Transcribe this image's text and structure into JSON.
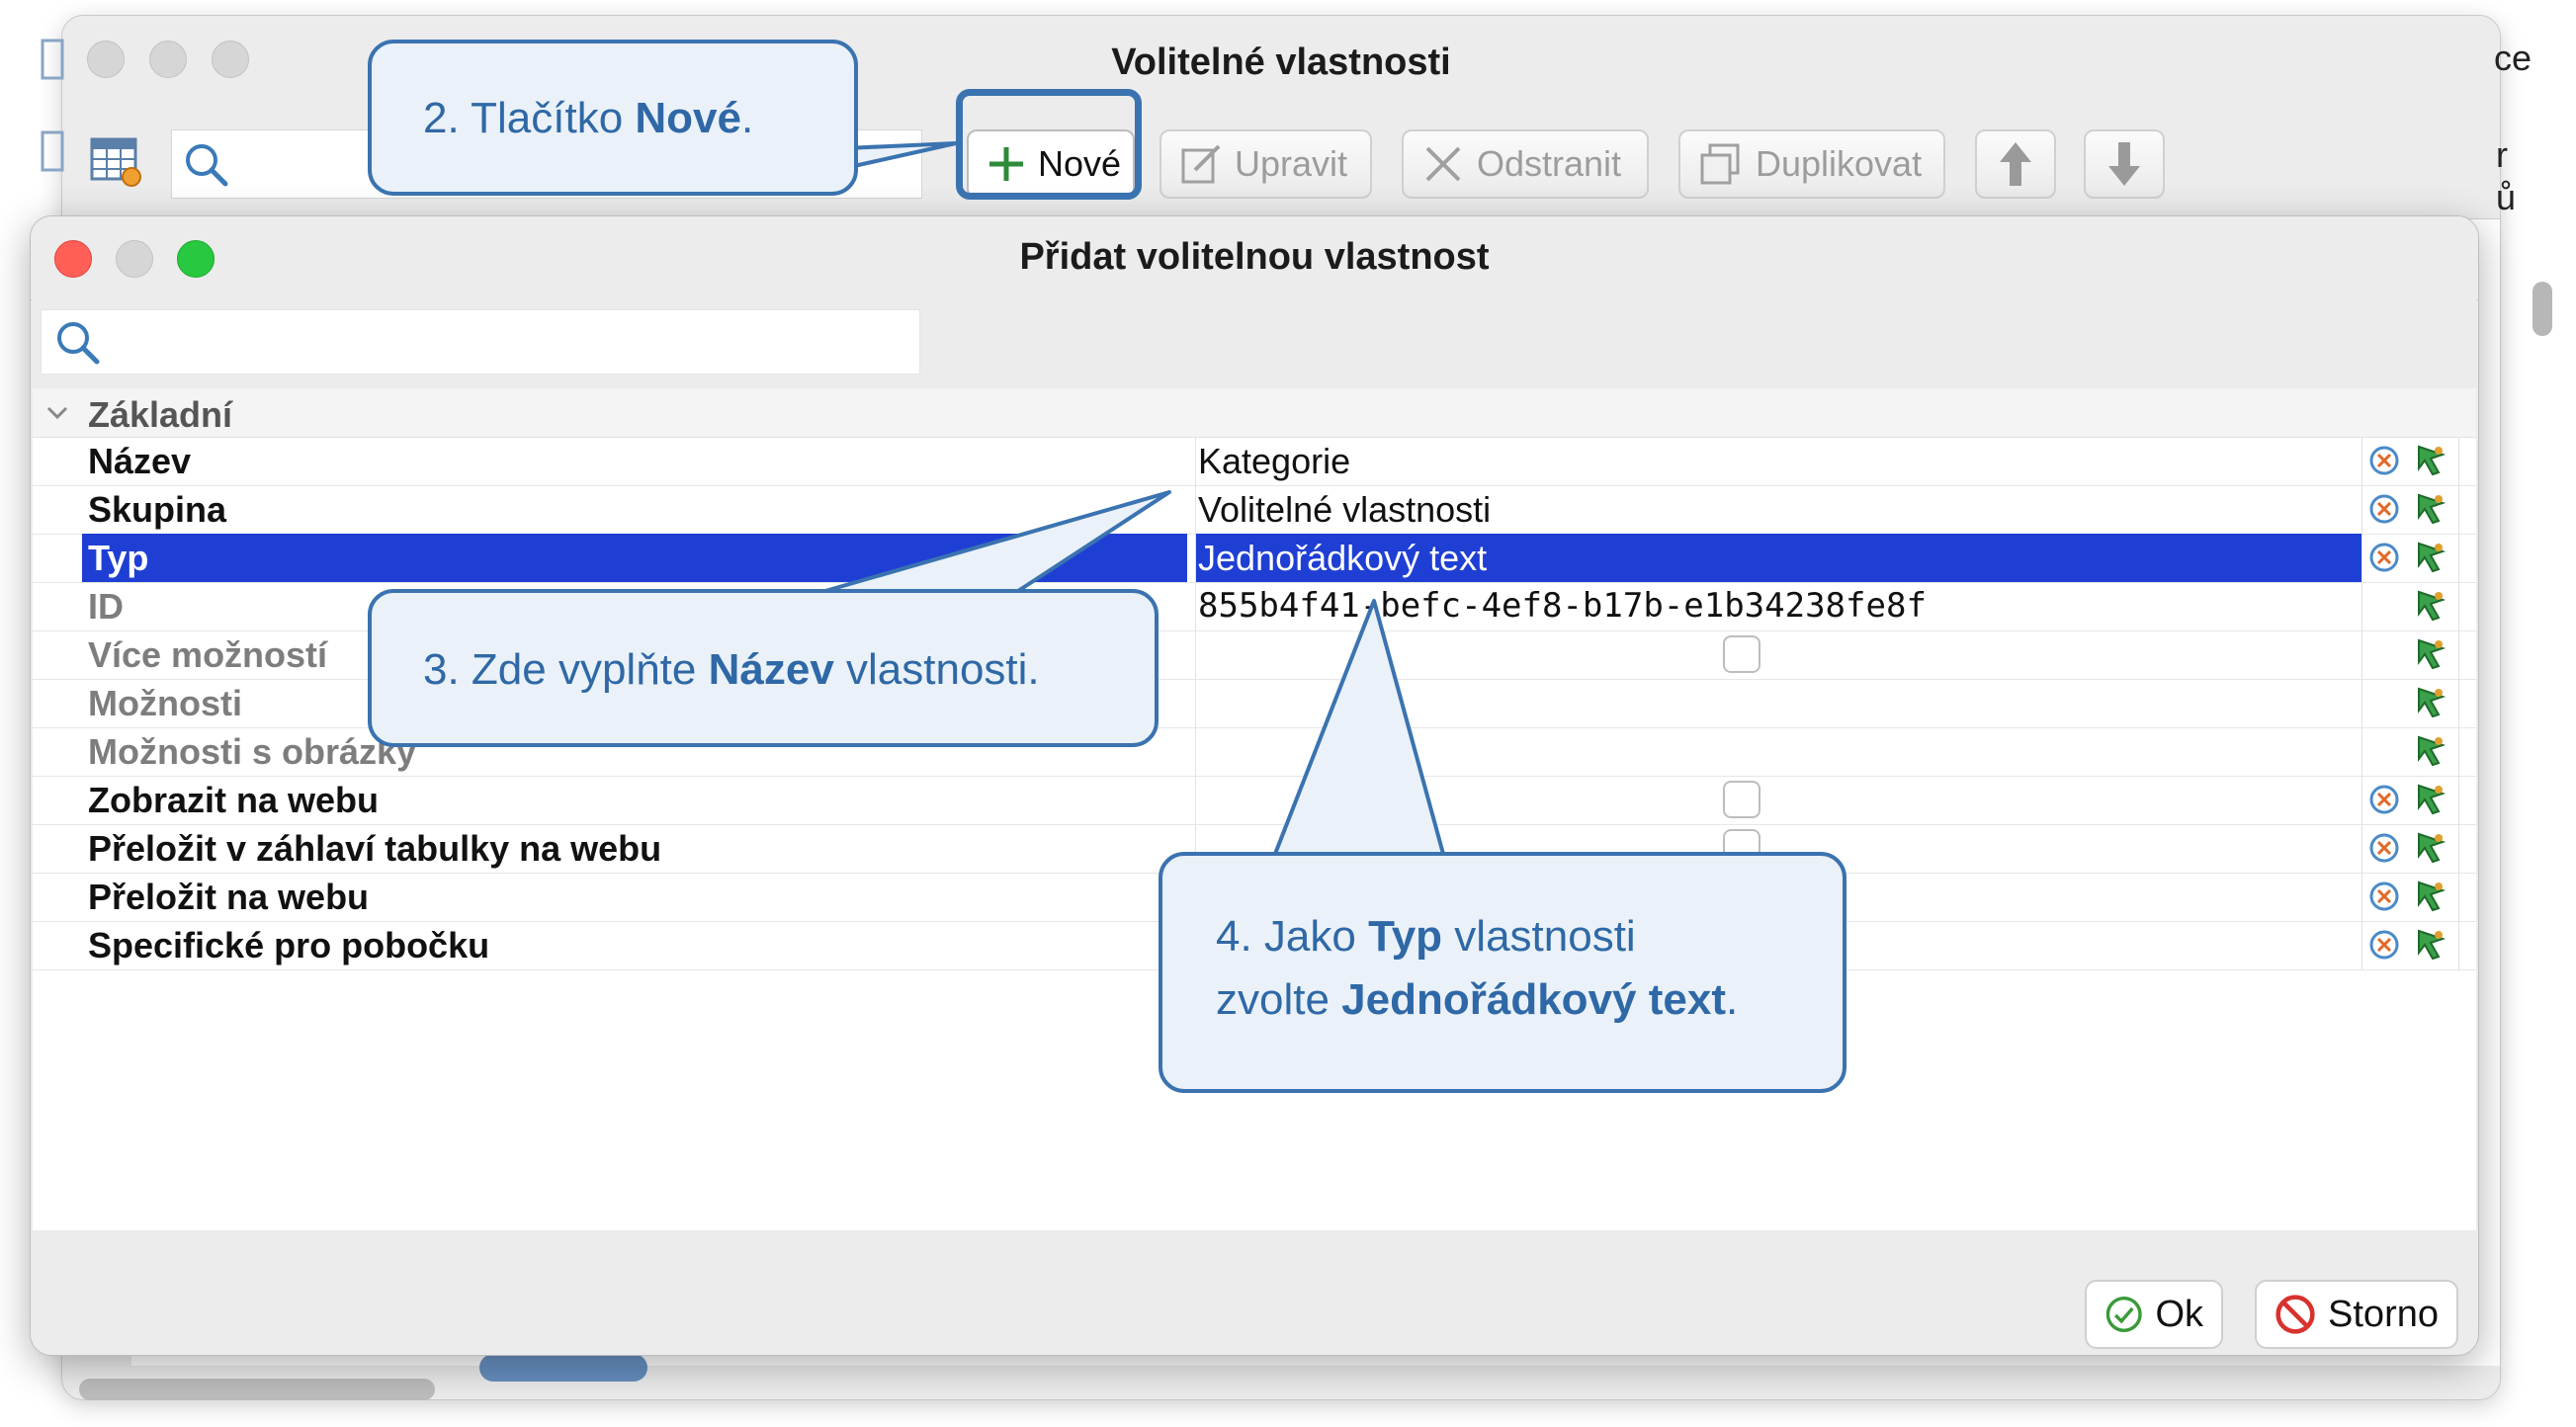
{
  "back_window": {
    "title": "Volitelné vlastnosti",
    "right_fragment_top": "ce",
    "right_fragment_mid1": "r",
    "right_fragment_mid2": "ů",
    "toolbar": {
      "new_label": "Nové",
      "edit_label": "Upravit",
      "delete_label": "Odstranit",
      "duplicate_label": "Duplikovat"
    }
  },
  "dialog": {
    "title": "Přidat volitelnou vlastnost",
    "group_label": "Základní",
    "rows": [
      {
        "name": "Název",
        "value": "Kategorie"
      },
      {
        "name": "Skupina",
        "value": "Volitelné vlastnosti"
      },
      {
        "name": "Typ",
        "value": "Jednořádkový text"
      },
      {
        "name": "ID",
        "value": "855b4f41-befc-4ef8-b17b-e1b34238fe8f"
      },
      {
        "name": "Více možností",
        "value": ""
      },
      {
        "name": "Možnosti",
        "value": ""
      },
      {
        "name": "Možnosti s obrázky",
        "value": ""
      },
      {
        "name": "Zobrazit na webu",
        "value": ""
      },
      {
        "name": "Přeložit v záhlaví tabulky na webu",
        "value": ""
      },
      {
        "name": "Přeložit na webu",
        "value": ""
      },
      {
        "name": "Specifické pro pobočku",
        "value": ""
      }
    ],
    "ok_label": "Ok",
    "cancel_label": "Storno"
  },
  "callouts": {
    "c2": {
      "prefix": "2. Tlačítko ",
      "bold": "Nové",
      "suffix": "."
    },
    "c3": {
      "prefix": "3. Zde vyplňte ",
      "bold": "Název",
      "suffix": " vlastnosti."
    },
    "c4": {
      "line1_prefix": "4. Jako ",
      "line1_bold": "Typ",
      "line1_suffix": " vlastnosti",
      "line2_prefix": "zvolte ",
      "line2_bold": "Jednořádkový text",
      "line2_suffix": "."
    }
  },
  "colors": {
    "selection": "#1f3fd4",
    "callout_border": "#3a73b0",
    "callout_fill": "#eaf1f8",
    "callout_text": "#2f68a6"
  }
}
